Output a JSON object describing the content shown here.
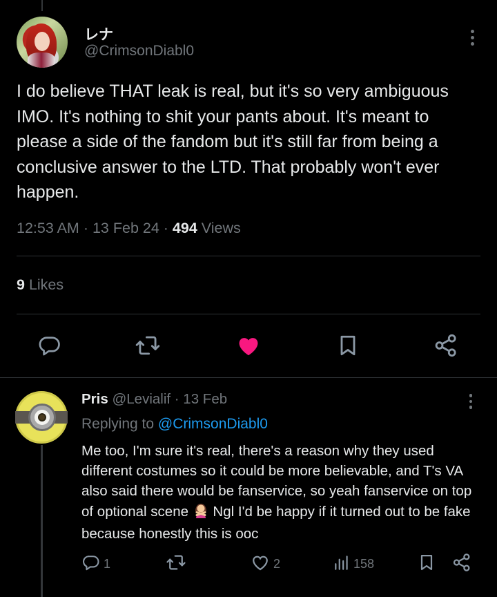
{
  "tweet": {
    "display_name": "レナ",
    "handle": "@CrimsonDiabl0",
    "text": "I do believe THAT leak is real, but it's so very ambiguous IMO. It's nothing to shit your pants about. It's meant to please a side of the fandom but it's still far from being a conclusive answer to the LTD. That probably won't ever happen.",
    "time": "12:53 AM",
    "date": "13 Feb 24",
    "views_count": "494",
    "views_label": "Views",
    "likes_count": "9",
    "likes_label": "Likes",
    "liked": true
  },
  "reply": {
    "display_name": "Pris",
    "handle": "@Levialif",
    "date": "· 13 Feb",
    "replying_label": "Replying to",
    "replying_to": "@CrimsonDiabl0",
    "text_before_emoji": "Me too, I'm sure it's real, there's a reason why they used different costumes so it could be more believable, and T's VA also said there would be fanservice, so yeah fanservice on top of optional scene",
    "text_after_emoji": " Ngl I'd be happy if it turned out to be fake because honestly this is ooc",
    "emoji_name": "woman-gesturing-no",
    "replies_count": "1",
    "likes_count": "2",
    "views_count": "158"
  },
  "colors": {
    "background": "#000000",
    "text_primary": "#e7e9ea",
    "text_secondary": "#71767b",
    "accent_blue": "#1d9bf0",
    "like_pink": "#f91880",
    "divider": "#2f3336"
  },
  "icons": [
    "more-vertical-icon",
    "reply-icon",
    "retweet-icon",
    "heart-icon",
    "bookmark-icon",
    "share-icon",
    "views-icon"
  ]
}
